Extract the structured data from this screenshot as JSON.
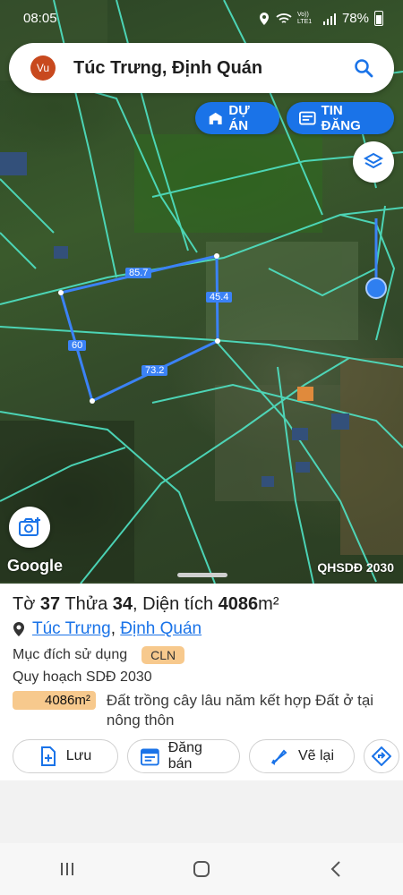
{
  "status_bar": {
    "time": "08:05",
    "battery": "78%",
    "network": "Vo)) LTE1"
  },
  "search": {
    "avatar_initials": "Vu",
    "query": "Túc Trưng, Định Quán"
  },
  "map_buttons": {
    "du_an": "DỰ ÁN",
    "tin_dang": "TIN ĐĂNG"
  },
  "map_labels": {
    "google": "Google",
    "plan_layer": "QHSDĐ 2030",
    "edge_top": "85.7",
    "edge_right": "45.4",
    "edge_left": "60",
    "edge_bottom": "73.2"
  },
  "parcel": {
    "to_label": "Tờ",
    "to_value": "37",
    "thua_label": "Thửa",
    "thua_value": "34",
    "dien_tich_label": "Diện tích",
    "dien_tich_value": "4086",
    "dien_tich_unit": "m²",
    "location_commune": "Túc Trưng",
    "location_comma": ",",
    "location_district": "Định Quán",
    "purpose_label": "Mục đích sử dụng",
    "purpose_code": "CLN",
    "plan_label": "Quy hoạch SDĐ 2030",
    "plan_area": "4086m²",
    "plan_desc": "Đất trồng cây lâu năm kết hợp Đất ở tại nông thôn"
  },
  "actions": {
    "save": "Lưu",
    "sell": "Đăng bán",
    "redraw": "Vẽ lại"
  },
  "colors": {
    "accent": "#1a73e8",
    "parcel_line": "#3b82f6",
    "boundary_line": "#4fe3c5",
    "badge": "#f7c98d"
  }
}
